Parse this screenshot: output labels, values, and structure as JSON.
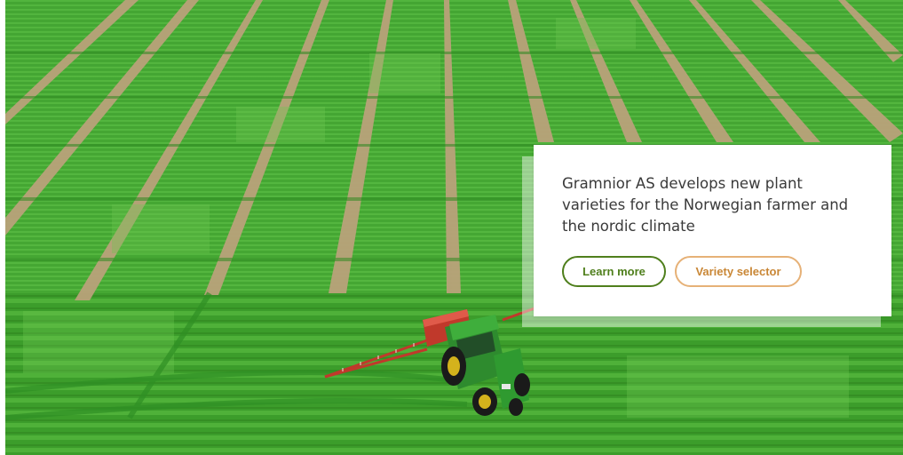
{
  "hero": {
    "headline": "Gramnior AS develops new plant varieties for the Norwegian farmer and the nordic climate",
    "learn_more_label": "Learn more",
    "variety_selector_label": "Variety selector"
  },
  "colors": {
    "primary_green": "#4f7f1c",
    "accent_orange": "#e6b177",
    "field_green": "#3f9a2a",
    "tractor_green": "#2e8b2e",
    "sprayer_red": "#c0392b"
  }
}
